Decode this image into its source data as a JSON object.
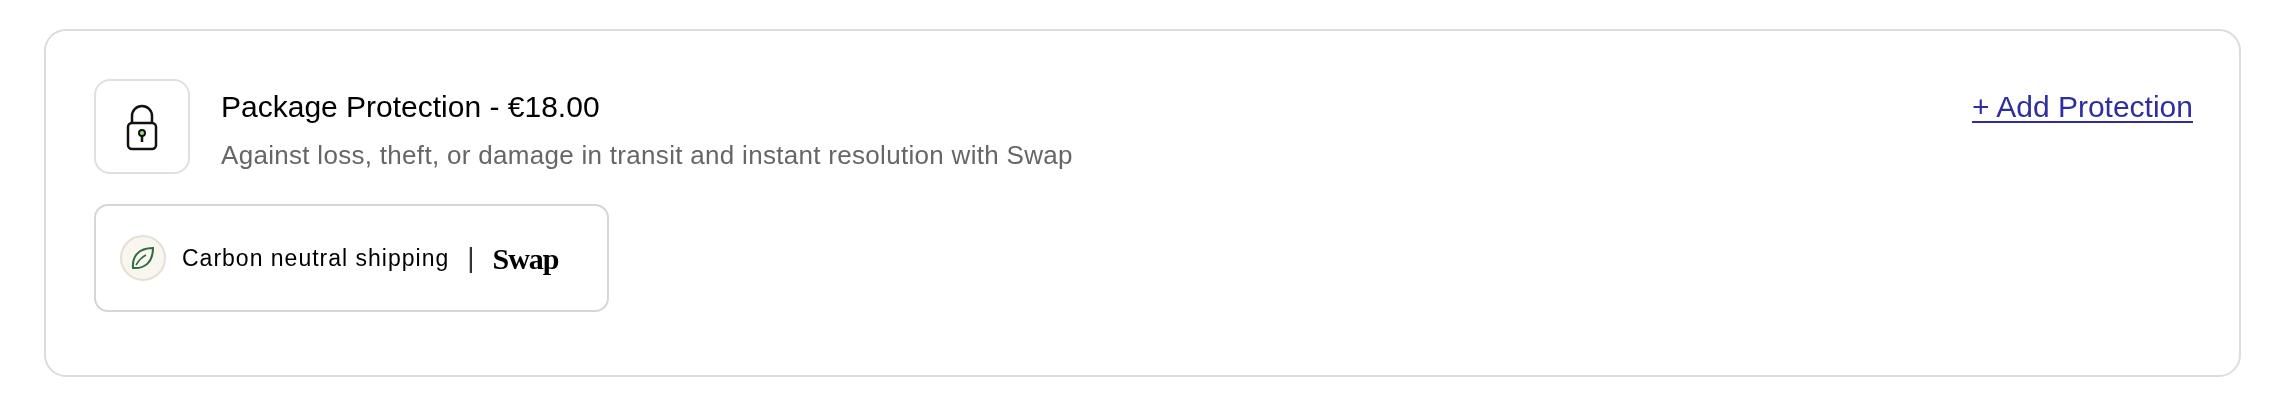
{
  "protection": {
    "title": "Package Protection - €18.00",
    "description": "Against loss, theft, or damage in transit and instant resolution with Swap",
    "action": "+ Add Protection"
  },
  "badge": {
    "label": "Carbon neutral shipping",
    "separator": "|",
    "brand": "Swap"
  }
}
